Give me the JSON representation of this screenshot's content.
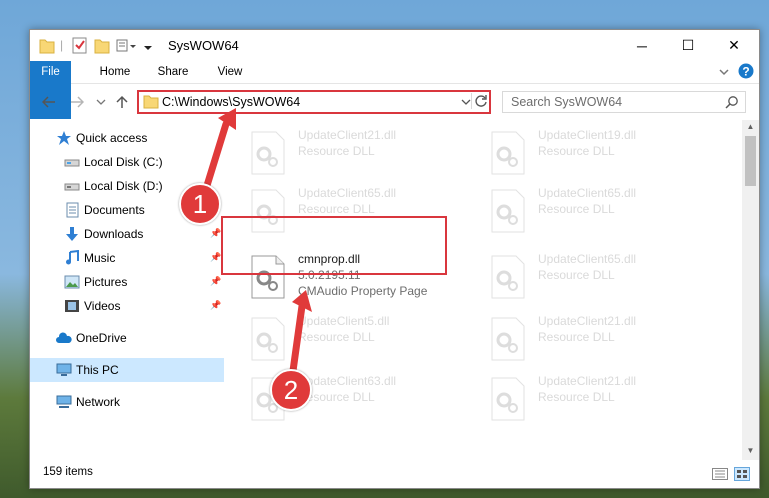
{
  "window": {
    "title": "SysWOW64",
    "controls": {
      "minimize": "─",
      "maximize": "☐",
      "close": "✕"
    }
  },
  "ribbon": {
    "tabs": [
      "File",
      "Home",
      "Share",
      "View"
    ],
    "collapse_icon": "chevron-down-icon",
    "help_icon": "help-icon"
  },
  "address": {
    "path": "C:\\Windows\\SysWOW64",
    "search_placeholder": "Search SysWOW64"
  },
  "nav": {
    "items": [
      {
        "label": "Quick access",
        "icon": "star-icon",
        "pinned": false
      },
      {
        "label": "Local Disk (C:)",
        "icon": "drive-icon",
        "pinned": false
      },
      {
        "label": "Local Disk (D:)",
        "icon": "drive-icon",
        "pinned": false
      },
      {
        "label": "Documents",
        "icon": "documents-icon",
        "pinned": true
      },
      {
        "label": "Downloads",
        "icon": "download-icon",
        "pinned": true
      },
      {
        "label": "Music",
        "icon": "music-icon",
        "pinned": true
      },
      {
        "label": "Pictures",
        "icon": "pictures-icon",
        "pinned": true
      },
      {
        "label": "Videos",
        "icon": "videos-icon",
        "pinned": true
      },
      {
        "label": "OneDrive",
        "icon": "cloud-icon",
        "pinned": false
      },
      {
        "label": "This PC",
        "icon": "computer-icon",
        "pinned": false,
        "selected": true
      },
      {
        "label": "Network",
        "icon": "network-icon",
        "pinned": false
      }
    ]
  },
  "files": [
    {
      "name": "UpdateClient21.dll",
      "desc": "Resource DLL",
      "faded": true
    },
    {
      "name": "UpdateClient19.dll",
      "desc": "Resource DLL",
      "faded": true
    },
    {
      "name": "UpdateClient65.dll",
      "desc": "Resource DLL",
      "faded": true
    },
    {
      "name": "UpdateClient65.dll",
      "desc": "Resource DLL",
      "faded": true
    },
    {
      "name": "cmnprop.dll",
      "version": "5.0.2195.11",
      "desc": "CMAudio Property Page",
      "faded": false
    },
    {
      "name": "UpdateClient65.dll",
      "desc": "Resource DLL",
      "faded": true
    },
    {
      "name": "UpdateClient5.dll",
      "desc": "Resource DLL",
      "faded": true
    },
    {
      "name": "UpdateClient21.dll",
      "desc": "Resource DLL",
      "faded": true
    },
    {
      "name": "UpdateClient63.dll",
      "desc": "Resource DLL",
      "faded": true
    },
    {
      "name": "UpdateClient21.dll",
      "desc": "Resource DLL",
      "faded": true
    }
  ],
  "status": {
    "items_count": "159 items"
  },
  "callouts": [
    "1",
    "2"
  ],
  "colors": {
    "accent": "#1979ca",
    "highlight": "#d9363e",
    "selected": "#cce8ff"
  }
}
